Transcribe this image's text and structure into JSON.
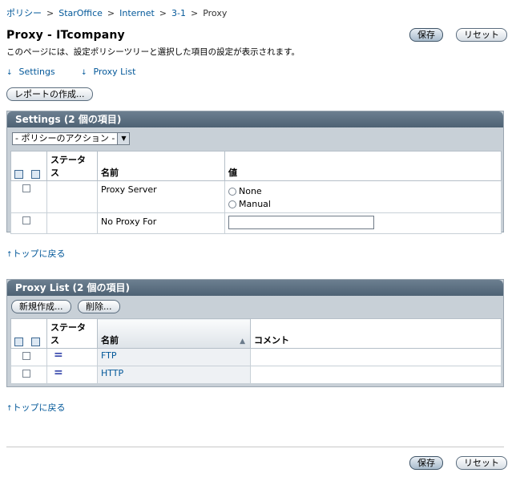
{
  "breadcrumb": {
    "items": [
      "ポリシー",
      "StarOffice",
      "Internet",
      "3-1"
    ],
    "current": "Proxy",
    "separator": ">"
  },
  "header": {
    "title": "Proxy - ITcompany",
    "description": "このページには、設定ポリシーツリーと選択した項目の設定が表示されます。",
    "save_label": "保存",
    "reset_label": "リセット"
  },
  "jump_links": {
    "settings": "Settings",
    "proxy_list": "Proxy List"
  },
  "report_button": "レポートの作成...",
  "settings": {
    "title": "Settings (2 個の項目)",
    "action_select": "- ポリシーのアクション -",
    "columns": {
      "status": "ステータス",
      "name": "名前",
      "value": "値"
    },
    "rows": [
      {
        "name": "Proxy Server",
        "options": [
          "None",
          "Manual"
        ]
      },
      {
        "name": "No Proxy For",
        "value": ""
      }
    ]
  },
  "back_to_top": "トップに戻る",
  "proxy_list": {
    "title": "Proxy List (2 個の項目)",
    "new_label": "新規作成...",
    "delete_label": "削除...",
    "columns": {
      "status": "ステータス",
      "name": "名前",
      "comment": "コメント"
    },
    "rows": [
      {
        "status": "=",
        "name": "FTP",
        "comment": ""
      },
      {
        "status": "=",
        "name": "HTTP",
        "comment": ""
      }
    ]
  },
  "footer": {
    "save_label": "保存",
    "reset_label": "リセット"
  }
}
